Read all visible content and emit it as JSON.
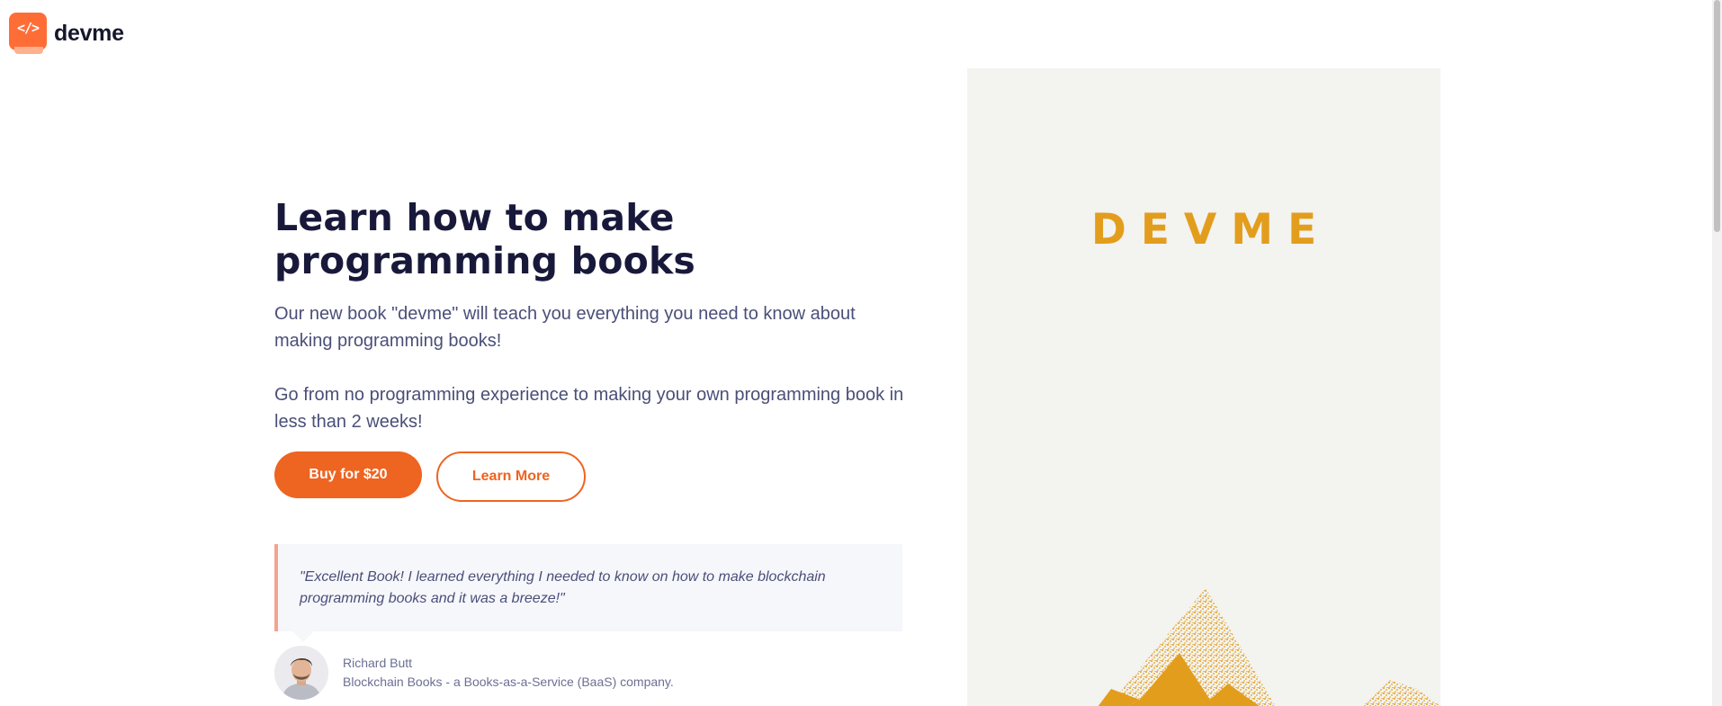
{
  "brand": {
    "logo_glyph": "</>",
    "name": "devme",
    "accent": "#ee6421"
  },
  "hero": {
    "title": "Learn how to make programming books",
    "paragraph_1": "Our new book \"devme\" will teach you everything you need to know about making programming books!",
    "paragraph_2": "Go from no programming experience to making your own programming book in less than 2 weeks!"
  },
  "actions": {
    "buy_label": "Buy for $20",
    "learn_label": "Learn More"
  },
  "testimonial": {
    "quote": "\"Excellent Book! I learned everything I needed to know on how to make blockchain programming books and it was a breeze!\"",
    "author_name": "Richard Butt",
    "author_role": "Blockchain Books - a Books-as-a-Service (BaaS) company."
  },
  "cover": {
    "title": "DEVME",
    "title_color": "#e39d1d",
    "background": "#f3f3ef",
    "art": "mountain-illustration"
  }
}
